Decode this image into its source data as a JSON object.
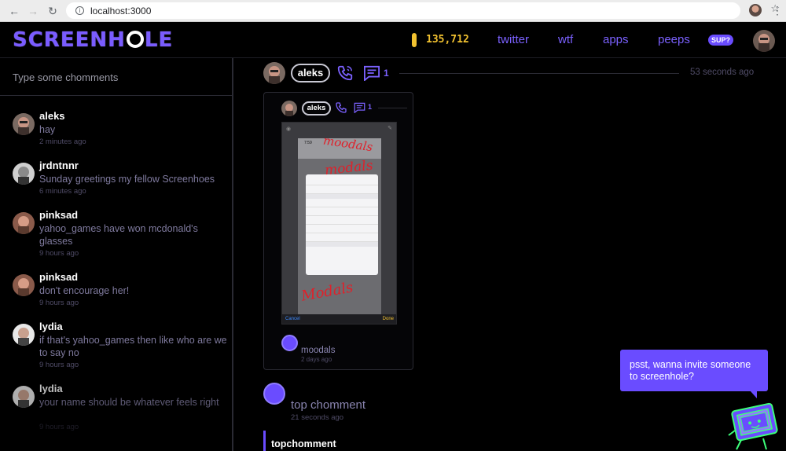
{
  "browser": {
    "url": "localhost:3000"
  },
  "header": {
    "logo": "SCREENHOLE",
    "coins": "135,712",
    "nav": [
      "twitter",
      "wtf",
      "apps",
      "peeps"
    ],
    "sup_label": "SUP?"
  },
  "sidebar": {
    "input_placeholder": "Type some chomments",
    "comments": [
      {
        "name": "aleks",
        "text": "hay",
        "time": "2 minutes ago"
      },
      {
        "name": "jrdntnnr",
        "text": "Sunday greetings my fellow Screenhoes",
        "time": "6 minutes ago"
      },
      {
        "name": "pinksad",
        "text": "yahoo_games have won mcdonald's glasses",
        "time": "9 hours ago"
      },
      {
        "name": "pinksad",
        "text": "don't encourage her!",
        "time": "9 hours ago"
      },
      {
        "name": "lydia",
        "text": "if that's yahoo_games then like who are we to say no",
        "time": "9 hours ago"
      },
      {
        "name": "lydia",
        "text": "your name should be whatever feels right",
        "time": "9 hours ago"
      }
    ]
  },
  "post": {
    "user": "aleks",
    "chomment_count": "1",
    "time": "53 seconds ago",
    "card": {
      "user": "aleks",
      "chomment_count": "1",
      "screenshot": {
        "status_time": "7:59",
        "bottom_cancel": "Cancel",
        "bottom_done": "Done",
        "scribbles": [
          "moodals",
          "modals",
          "Modals"
        ]
      },
      "commenter": "moodals",
      "commenter_time": "2 days ago"
    }
  },
  "top_chomment": {
    "title": "top chomment",
    "time": "21 seconds ago",
    "text": "topchomment"
  },
  "invite": {
    "text": "psst, wanna invite someone to screenhole?"
  },
  "colors": {
    "accent": "#6a4cff",
    "nav": "#7b61ff",
    "coin": "#f2c230",
    "background": "#000000"
  }
}
